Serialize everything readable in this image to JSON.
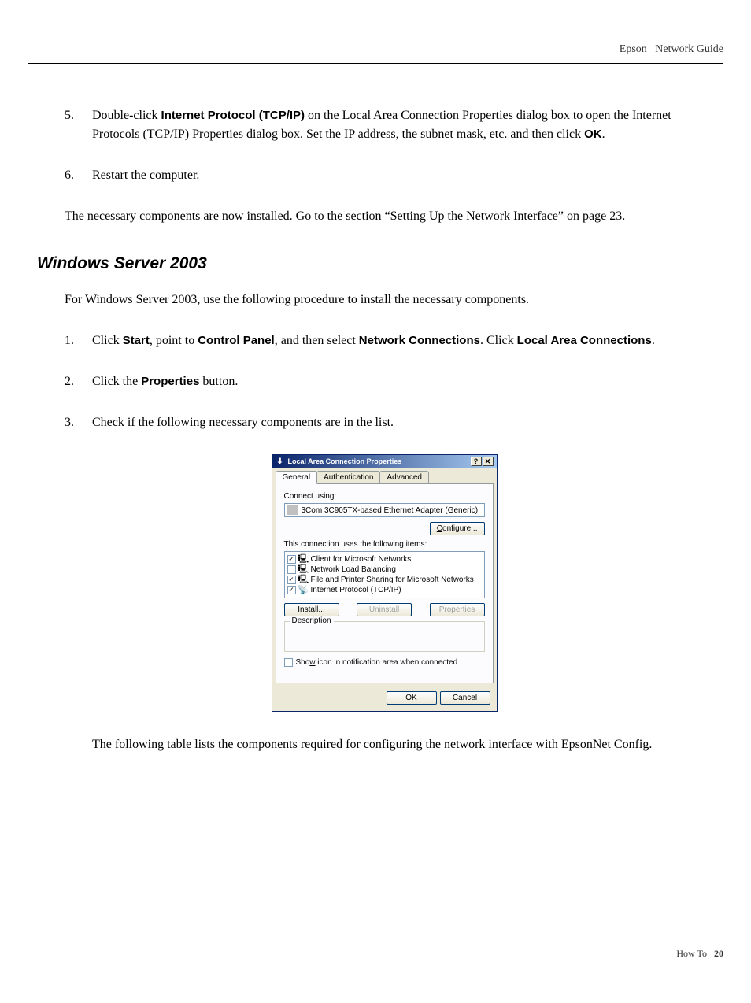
{
  "header": {
    "brand": "Epson",
    "doc_title": "Network Guide"
  },
  "steps_top": [
    {
      "num": "5.",
      "pre": "Double-click ",
      "bold1": "Internet Protocol (TCP/IP)",
      "mid": " on the Local Area Connection Properties dialog box to open the Internet Protocols (TCP/IP) Properties dialog box. Set the IP address, the subnet mask, etc. and then click ",
      "bold2": "OK",
      "post": "."
    },
    {
      "num": "6.",
      "text": "Restart the computer."
    }
  ],
  "after_steps": "The necessary components are now installed. Go to the section “Setting Up the Network Interface” on page 23.",
  "section_heading": "Windows Server 2003",
  "section_intro": "For Windows Server 2003, use the following procedure to install the necessary components.",
  "steps_bottom": [
    {
      "num": "1.",
      "pre": "Click ",
      "b1": "Start",
      "m1": ", point to ",
      "b2": "Control Panel",
      "m2": ", and then select ",
      "b3": "Network Connections",
      "m3": ". Click ",
      "b4": "Local Area Connections",
      "post": "."
    },
    {
      "num": "2.",
      "pre": "Click the ",
      "b1": "Properties",
      "post": " button."
    },
    {
      "num": "3.",
      "text": "Check if the following necessary components are in the list."
    }
  ],
  "dialog": {
    "title": "Local Area Connection Properties",
    "tabs": [
      "General",
      "Authentication",
      "Advanced"
    ],
    "connect_label": "Connect using:",
    "adapter": "3Com 3C905TX-based Ethernet Adapter (Generic)",
    "configure_btn": "Configure...",
    "items_label": "This connection uses the following items:",
    "items": [
      {
        "checked": true,
        "label": "Client for Microsoft Networks"
      },
      {
        "checked": false,
        "label": "Network Load Balancing"
      },
      {
        "checked": true,
        "label": "File and Printer Sharing for Microsoft Networks"
      },
      {
        "checked": true,
        "label": "Internet Protocol (TCP/IP)"
      }
    ],
    "install_btn": "Install...",
    "uninstall_btn": "Uninstall",
    "properties_btn": "Properties",
    "description_label": "Description",
    "show_icon": "Show icon in notification area when connected",
    "ok_btn": "OK",
    "cancel_btn": "Cancel"
  },
  "after_dialog": "The following table lists the components required for configuring the network interface with EpsonNet Config.",
  "footer": {
    "section": "How To",
    "page": "20"
  }
}
